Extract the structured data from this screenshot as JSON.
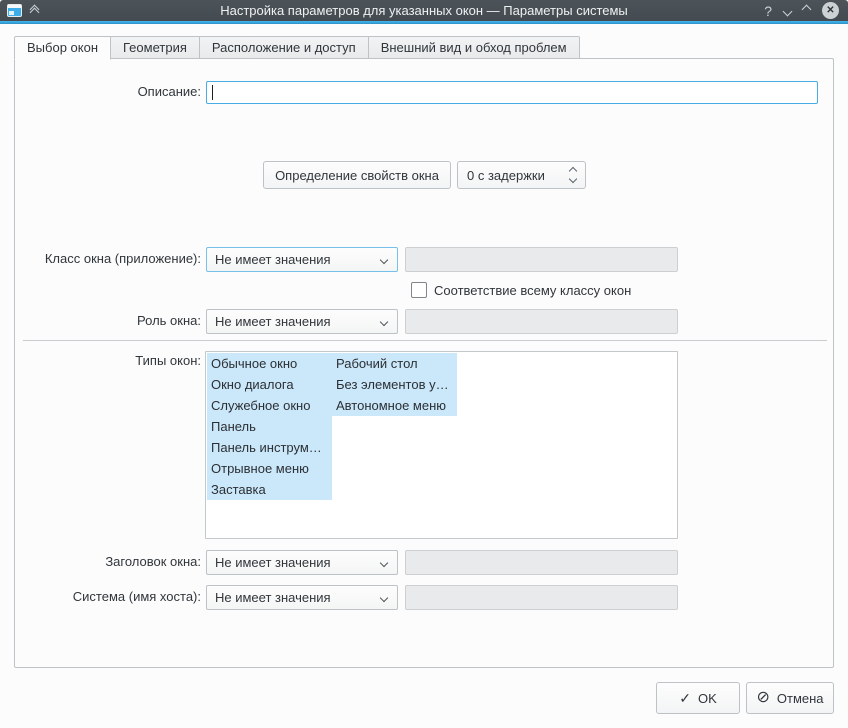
{
  "titlebar": {
    "title": "Настройка параметров для указанных окон — Параметры системы",
    "help_glyph": "?",
    "close_glyph": "✕"
  },
  "tabs": [
    {
      "label": "Выбор окон",
      "active": true
    },
    {
      "label": "Геометрия",
      "active": false
    },
    {
      "label": "Расположение и доступ",
      "active": false
    },
    {
      "label": "Внешний вид и обход проблем",
      "active": false
    }
  ],
  "form": {
    "description_label": "Описание:",
    "description_value": "",
    "detect_button_label": "Определение свойств окна",
    "delay_spinner_value": "0 с задержки",
    "rows": [
      {
        "label": "Класс окна (приложение):",
        "combo_value": "Не имеет значения",
        "field_value": ""
      },
      {
        "label": "Роль окна:",
        "combo_value": "Не имеет значения",
        "field_value": ""
      },
      {
        "label": "Заголовок окна:",
        "combo_value": "Не имеет значения",
        "field_value": ""
      },
      {
        "label": "Система (имя хоста):",
        "combo_value": "Не имеет значения",
        "field_value": ""
      }
    ],
    "match_whole_class_label": "Соответствие всему классу окон",
    "match_whole_class_checked": false,
    "window_types_label": "Типы окон:",
    "window_types_columns": [
      [
        "Обычное окно",
        "Окно диалога",
        "Служебное окно",
        "Панель",
        "Панель инструм…",
        "Отрывное меню",
        "Заставка"
      ],
      [
        "Рабочий стол",
        "Без элементов у…",
        "Автономное меню"
      ]
    ],
    "window_types_all_selected": true
  },
  "footer": {
    "ok_label": "OK",
    "cancel_label": "Отмена"
  },
  "colors": {
    "accent": "#3daee9",
    "titlebar_bg": "#464d53",
    "selection_highlight": "#cbe7fa",
    "focus_border": "#47ade4",
    "window_bg": "#fcfcfc",
    "disabled_field_bg": "#e9eaeb"
  }
}
